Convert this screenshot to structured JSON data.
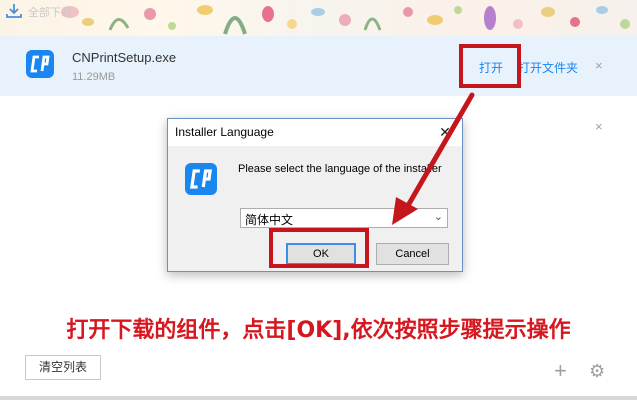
{
  "banner": {
    "label": "全部下载",
    "download_icon": "download-arrow-icon"
  },
  "download_item": {
    "file_name": "CNPrintSetup.exe",
    "file_size": "11.29MB",
    "open_label": "打开",
    "open_folder_label": "打开文件夹",
    "close_glyph": "×",
    "icon": "cnprint-app-icon"
  },
  "area_close_glyph": "×",
  "dialog": {
    "title": "Installer Language",
    "close_glyph": "✕",
    "message": "Please select the language of the installer",
    "selected_language": "简体中文",
    "dropdown_glyph": "⌄",
    "ok_label": "OK",
    "cancel_label": "Cancel"
  },
  "annotation": {
    "instruction": "打开下载的组件，点击[OK],依次按照步骤提示操作",
    "highlight_color": "#c4161c"
  },
  "footer": {
    "clear_list_label": "清空列表",
    "add_glyph": "+",
    "settings_glyph": "⚙"
  },
  "colors": {
    "accent": "#1a86f0",
    "row_highlight": "#e8f2fc",
    "annotation_red": "#d6171f"
  }
}
